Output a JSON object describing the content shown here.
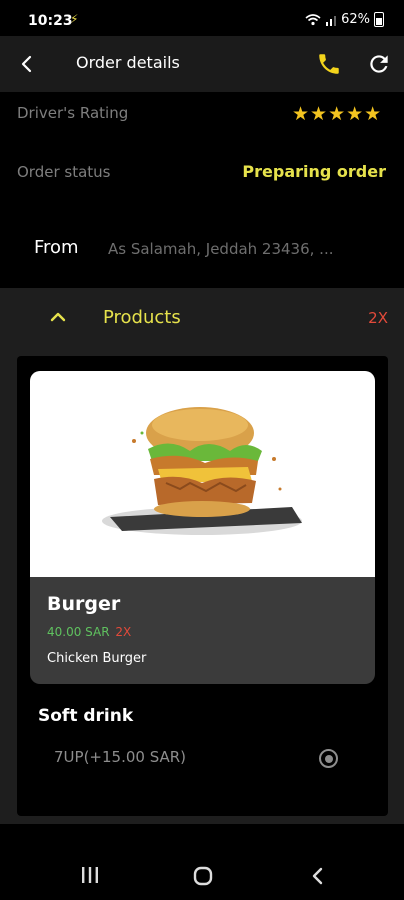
{
  "status_bar": {
    "time": "10:23",
    "battery": "62%"
  },
  "header": {
    "title": "Order details"
  },
  "drivers_rating": {
    "label": "Driver's Rating",
    "stars": "★★★★★",
    "rating": 5
  },
  "order_status": {
    "label": "Order status",
    "value": "Preparing order"
  },
  "from": {
    "label": "From",
    "value": "As Salamah, Jeddah 23436, ..."
  },
  "products": {
    "label": "Products",
    "count": "2X",
    "items": [
      {
        "name": "Burger",
        "price": "40.00 SAR",
        "qty": "2X",
        "description": "Chicken Burger"
      }
    ],
    "addon": {
      "title": "Soft drink",
      "option_name": "7UP(+15.00 SAR)",
      "selected": true
    }
  },
  "colors": {
    "accent_yellow": "#e6e24c",
    "star_yellow": "#f3c420",
    "price_green": "#5fc15f",
    "qty_red": "#e24a3a",
    "app_bar_bg": "#1b1b1b",
    "section_bg": "#1e1e1e"
  },
  "icons": [
    "back-arrow-icon",
    "phone-icon",
    "refresh-icon",
    "chevron-up-icon",
    "radio-selected-icon",
    "recents-icon",
    "home-icon",
    "nav-back-icon"
  ]
}
